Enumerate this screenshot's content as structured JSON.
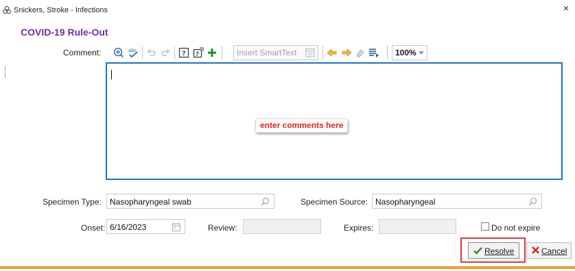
{
  "window": {
    "title": "Snickers, Stroke - Infections",
    "close_glyph": "×"
  },
  "heading": "COVID-19 Rule-Out",
  "comment": {
    "label": "Comment:",
    "placeholder_callout": "enter comments here",
    "toolbar": {
      "icons": [
        "add-circle-icon",
        "spellcheck-icon",
        "undo-icon",
        "redo-icon",
        "help-question-icon",
        "help-question-alt-icon",
        "add-plus-icon",
        "arrow-left-icon",
        "arrow-right-icon",
        "eraser-icon",
        "insert-list-icon"
      ],
      "smarttext_placeholder": "Insert SmartText",
      "zoom": "100%"
    }
  },
  "specimen": {
    "type_label": "Specimen Type:",
    "type_value": "Nasopharyngeal swab",
    "source_label": "Specimen Source:",
    "source_value": "Nasopharyngeal"
  },
  "dates": {
    "onset_label": "Onset:",
    "onset_value": "6/16/2023",
    "review_label": "Review:",
    "review_value": "",
    "expires_label": "Expires:",
    "expires_value": ""
  },
  "do_not_expire": {
    "label": "Do not expire",
    "checked": false
  },
  "buttons": {
    "resolve": "Resolve",
    "cancel": "Cancel"
  },
  "colors": {
    "heading": "#6f2da8",
    "accent_border": "#1b73c7",
    "callout_text": "#e8231b",
    "highlight": "#e0383a",
    "bottom_rule": "#f59a2f",
    "check_green": "#2e8b2e",
    "cancel_red": "#d9261c"
  }
}
